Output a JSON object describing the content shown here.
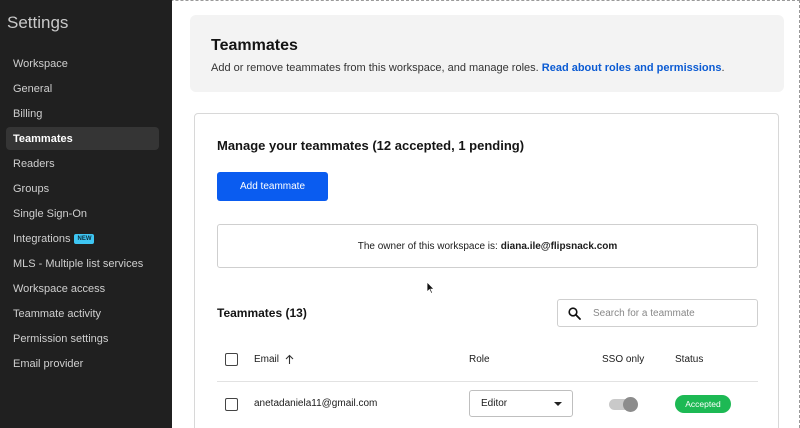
{
  "sidebar": {
    "title": "Settings",
    "items": [
      {
        "label": "Workspace"
      },
      {
        "label": "General"
      },
      {
        "label": "Billing"
      },
      {
        "label": "Teammates",
        "active": true
      },
      {
        "label": "Readers"
      },
      {
        "label": "Groups"
      },
      {
        "label": "Single Sign-On"
      },
      {
        "label": "Integrations",
        "badge": "NEW"
      },
      {
        "label": "MLS - Multiple list services"
      },
      {
        "label": "Workspace access"
      },
      {
        "label": "Teammate activity"
      },
      {
        "label": "Permission settings"
      },
      {
        "label": "Email provider"
      }
    ]
  },
  "header": {
    "title": "Teammates",
    "description": "Add or remove teammates from this workspace, and manage roles.",
    "link_text": "Read about roles and permissions",
    "link_suffix": "."
  },
  "manage": {
    "title": "Manage your teammates (12 accepted, 1 pending)",
    "add_button": "Add teammate",
    "owner_text": "The owner of this workspace is:",
    "owner_email": "diana.ile@flipsnack.com"
  },
  "teammates": {
    "heading": "Teammates (13)",
    "search_placeholder": "Search for a teammate",
    "columns": {
      "email": "Email",
      "role": "Role",
      "sso": "SSO only",
      "status": "Status"
    },
    "rows": [
      {
        "email": "anetadaniela11@gmail.com",
        "role": "Editor",
        "sso_only": false,
        "status": "Accepted"
      }
    ]
  },
  "colors": {
    "primary": "#0a5cf0",
    "link": "#0b5bd3",
    "accepted": "#1db954",
    "sidebar_bg": "#202020"
  }
}
